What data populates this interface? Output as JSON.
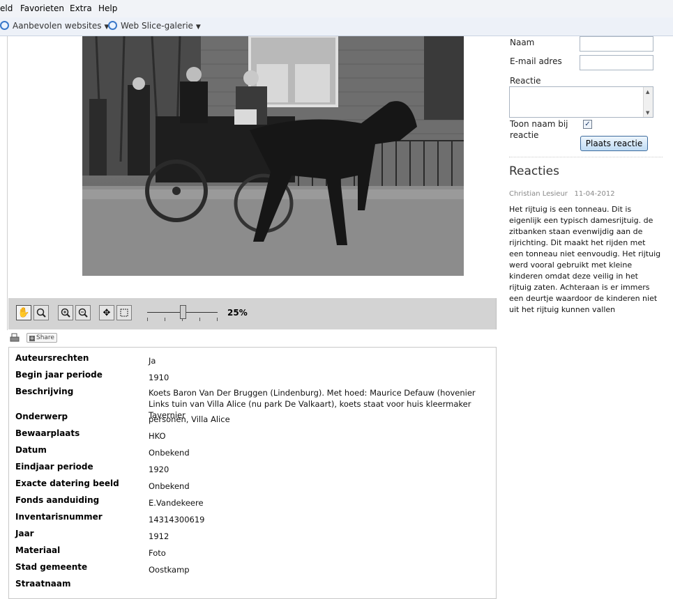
{
  "menu": [
    "eld",
    "Favorieten",
    "Extra",
    "Help"
  ],
  "favorites": [
    {
      "label": "Aanbevolen websites",
      "icon": "ie-page-icon"
    },
    {
      "label": "Web Slice-galerie",
      "icon": "ie-page-icon"
    }
  ],
  "viewer": {
    "zoom_label": "25%",
    "zoom_level_percent": 25,
    "tools": [
      "pan-tool",
      "magnifier-tool",
      "zoom-in",
      "zoom-out",
      "move",
      "fit-to-screen"
    ]
  },
  "share": {
    "label": "Share"
  },
  "metadata": [
    {
      "label": "Auteursrechten",
      "value": "Ja"
    },
    {
      "label": "Begin jaar periode",
      "value": "1910"
    },
    {
      "label": "Beschrijving",
      "value": "Koets Baron Van Der Bruggen (Lindenburg). Met hoed: Maurice Defauw (hovenier Links tuin van Villa Alice (nu park De Valkaart), koets staat voor huis kleermaker Tavernier"
    },
    {
      "label": "Onderwerp",
      "value": "personen, Villa Alice"
    },
    {
      "label": "Bewaarplaats",
      "value": "HKO"
    },
    {
      "label": "Datum",
      "value": "Onbekend"
    },
    {
      "label": "Eindjaar periode",
      "value": "1920"
    },
    {
      "label": "Exacte datering beeld",
      "value": "Onbekend"
    },
    {
      "label": "Fonds aanduiding",
      "value": "E.Vandekeere"
    },
    {
      "label": "Inventarisnummer",
      "value": "14314300619"
    },
    {
      "label": "Jaar",
      "value": "1912"
    },
    {
      "label": "Materiaal",
      "value": "Foto"
    },
    {
      "label": "Stad gemeente",
      "value": "Oostkamp"
    },
    {
      "label": "Straatnaam",
      "value": ""
    }
  ],
  "form": {
    "name_label": "Naam",
    "email_label": "E-mail adres",
    "reactie_label": "Reactie",
    "show_name_label_1": "Toon naam bij",
    "show_name_label_2": "reactie",
    "show_name_checked": true,
    "submit_label": "Plaats reactie"
  },
  "reacties": {
    "title": "Reacties",
    "items": [
      {
        "author": "Christian Lesieur",
        "date": "11-04-2012",
        "text": "Het rijtuig is een tonneau. Dit is eigenlijk een typisch damesrijtuig. de zitbanken staan evenwijdig aan de rijrichting. Dit maakt het rijden met een tonneau niet eenvoudig. Het rijtuig werd vooral gebruikt met kleine kinderen omdat deze veilig in het rijtuig zaten. Achteraan is er immers een deurtje waardoor de kinderen niet uit het rijtuig kunnen vallen"
      }
    ]
  }
}
